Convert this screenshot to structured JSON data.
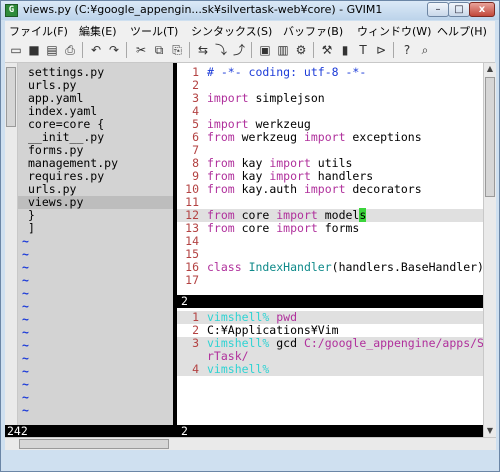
{
  "window": {
    "title": "views.py (C:¥google_appengin...sk¥silvertask-web¥core) - GVIM1",
    "app_icon_glyph": "G",
    "min_glyph": "–",
    "max_glyph": "□",
    "close_glyph": "x"
  },
  "menu": [
    "ファイル(F)",
    "編集(E)",
    "ツール(T)",
    "シンタックス(S)",
    "バッファ(B)",
    "ウィンドウ(W)",
    "ヘルプ(H)"
  ],
  "toolbar_icons": [
    "open-icon",
    "save-icon",
    "save-all-icon",
    "print-icon",
    "undo-icon",
    "redo-icon",
    "cut-icon",
    "copy-icon",
    "paste-icon",
    "search-replace-icon",
    "find-next-icon",
    "find-prev-icon",
    "load-session-icon",
    "save-session-icon",
    "run-script-icon",
    "make-icon",
    "shell-icon",
    "ctags-icon",
    "jump-tag-icon",
    "help-icon",
    "find-help-icon"
  ],
  "toolbar_glyphs": [
    "▭",
    "■",
    "▤",
    "⎙",
    "↶",
    "↷",
    "✂",
    "⧉",
    "⎘",
    "⇆",
    "⤵",
    "⤴",
    "▣",
    "▥",
    "⚙",
    "⚒",
    "▮",
    "T",
    "⊳",
    "?",
    "⌕"
  ],
  "left_tree": [
    "settings.py",
    "urls.py",
    "app.yaml",
    "index.yaml",
    "core=core {",
    "  __init__.py",
    "  forms.py",
    "  management.py",
    "  requires.py",
    "  urls.py",
    "  views.py",
    "}",
    "]"
  ],
  "left_tree_selected_index": 10,
  "tilde": "~",
  "left_status": "242",
  "code_lines": [
    {
      "n": "1",
      "t": "# -*- coding: utf-8 -*-"
    },
    {
      "n": "2",
      "t": ""
    },
    {
      "n": "3",
      "t": "import simplejson"
    },
    {
      "n": "4",
      "t": ""
    },
    {
      "n": "5",
      "t": "import werkzeug"
    },
    {
      "n": "6",
      "t": "from werkzeug import exceptions"
    },
    {
      "n": "7",
      "t": ""
    },
    {
      "n": "8",
      "t": "from kay import utils"
    },
    {
      "n": "9",
      "t": "from kay import handlers"
    },
    {
      "n": "10",
      "t": "from kay.auth import decorators"
    },
    {
      "n": "11",
      "t": ""
    },
    {
      "n": "12",
      "t": "from core import models"
    },
    {
      "n": "13",
      "t": "from core import forms"
    },
    {
      "n": "14",
      "t": ""
    },
    {
      "n": "15",
      "t": ""
    },
    {
      "n": "16",
      "t": "class IndexHandler(handlers.BaseHandler):"
    },
    {
      "n": "17",
      "t": ""
    }
  ],
  "code_status": "2",
  "term_lines": [
    {
      "n": "1",
      "prompt": "vimshell% ",
      "cmd": "pwd",
      "arg": ""
    },
    {
      "n": "2",
      "prompt": "",
      "cmd": "C:¥Applications¥Vim",
      "arg": ""
    },
    {
      "n": "3",
      "prompt": "vimshell% ",
      "cmd": "gcd ",
      "arg": "C:/google_appengine/apps/Silve"
    },
    {
      "n": "",
      "prompt": "",
      "cmd": "",
      "arg": "rTask/"
    },
    {
      "n": "4",
      "prompt": "vimshell% ",
      "cmd": "",
      "arg": ""
    }
  ],
  "term_status": "2"
}
